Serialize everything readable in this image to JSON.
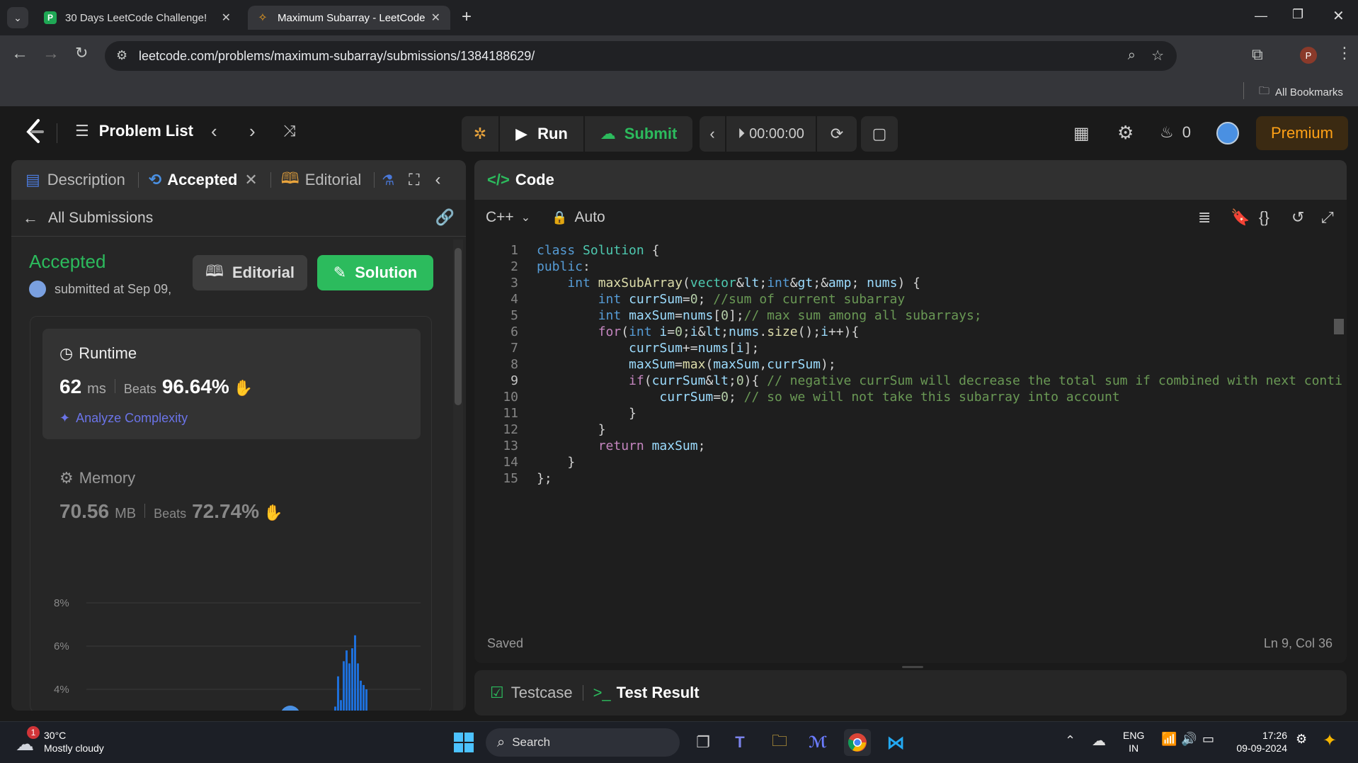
{
  "browser": {
    "tabs": [
      {
        "title": "30 Days LeetCode Challenge!",
        "favicon": "P",
        "active": false
      },
      {
        "title": "Maximum Subarray - LeetCode",
        "favicon": "leetcode",
        "active": true
      }
    ],
    "url": "leetcode.com/problems/maximum-subarray/submissions/1384188629/",
    "profile_initial": "P",
    "bookmarks_label": "All Bookmarks"
  },
  "header": {
    "problem_list": "Problem List",
    "run": "Run",
    "submit": "Submit",
    "timer": "00:00:00",
    "streak": "0",
    "premium": "Premium"
  },
  "left": {
    "tabs": {
      "description": "Description",
      "accepted": "Accepted",
      "editorial": "Editorial"
    },
    "all_submissions": "All Submissions",
    "status": "Accepted",
    "submitted": "submitted at Sep 09,",
    "editorial_btn": "Editorial",
    "solution_btn": "Solution",
    "runtime": {
      "label": "Runtime",
      "value": "62",
      "unit": "ms",
      "beats_label": "Beats",
      "beats": "96.64%"
    },
    "analyze": "Analyze Complexity",
    "memory": {
      "label": "Memory",
      "value": "70.56",
      "unit": "MB",
      "beats_label": "Beats",
      "beats": "72.74%"
    },
    "chart_labels": [
      "8%",
      "6%",
      "4%"
    ]
  },
  "chart_data": {
    "type": "bar",
    "yticks": [
      "8%",
      "6%",
      "4%"
    ],
    "values": [
      2.3,
      3.2,
      4.6,
      3.5,
      5.3,
      5.8,
      5.2,
      5.9,
      6.5,
      5.2,
      4.4,
      4.2,
      4.0,
      2.9,
      2.3
    ]
  },
  "code": {
    "title": "Code",
    "language": "C++",
    "mode": "Auto",
    "status": "Saved",
    "cursor": "Ln 9, Col 36",
    "current_line": 9,
    "lines": [
      "class Solution {",
      "public:",
      "    int maxSubArray(vector<int>& nums) {",
      "        int currSum=0; //sum of current subarray",
      "        int maxSum=nums[0];// max sum among all subarrays;",
      "        for(int i=0;i<nums.size();i++){",
      "            currSum+=nums[i];",
      "            maxSum=max(maxSum,currSum);",
      "            if(currSum<0){ // negative currSum will decrease the total sum if combined with next conti",
      "                currSum=0; // so we will not take this subarray into account",
      "            }",
      "        }",
      "        return maxSum;",
      "    }",
      "};"
    ]
  },
  "testpanel": {
    "testcase": "Testcase",
    "result": "Test Result"
  },
  "taskbar": {
    "weather_temp": "30°C",
    "weather_desc": "Mostly cloudy",
    "weather_badge": "1",
    "search": "Search",
    "lang_top": "ENG",
    "lang_bottom": "IN",
    "time": "17:26",
    "date": "09-09-2024"
  }
}
